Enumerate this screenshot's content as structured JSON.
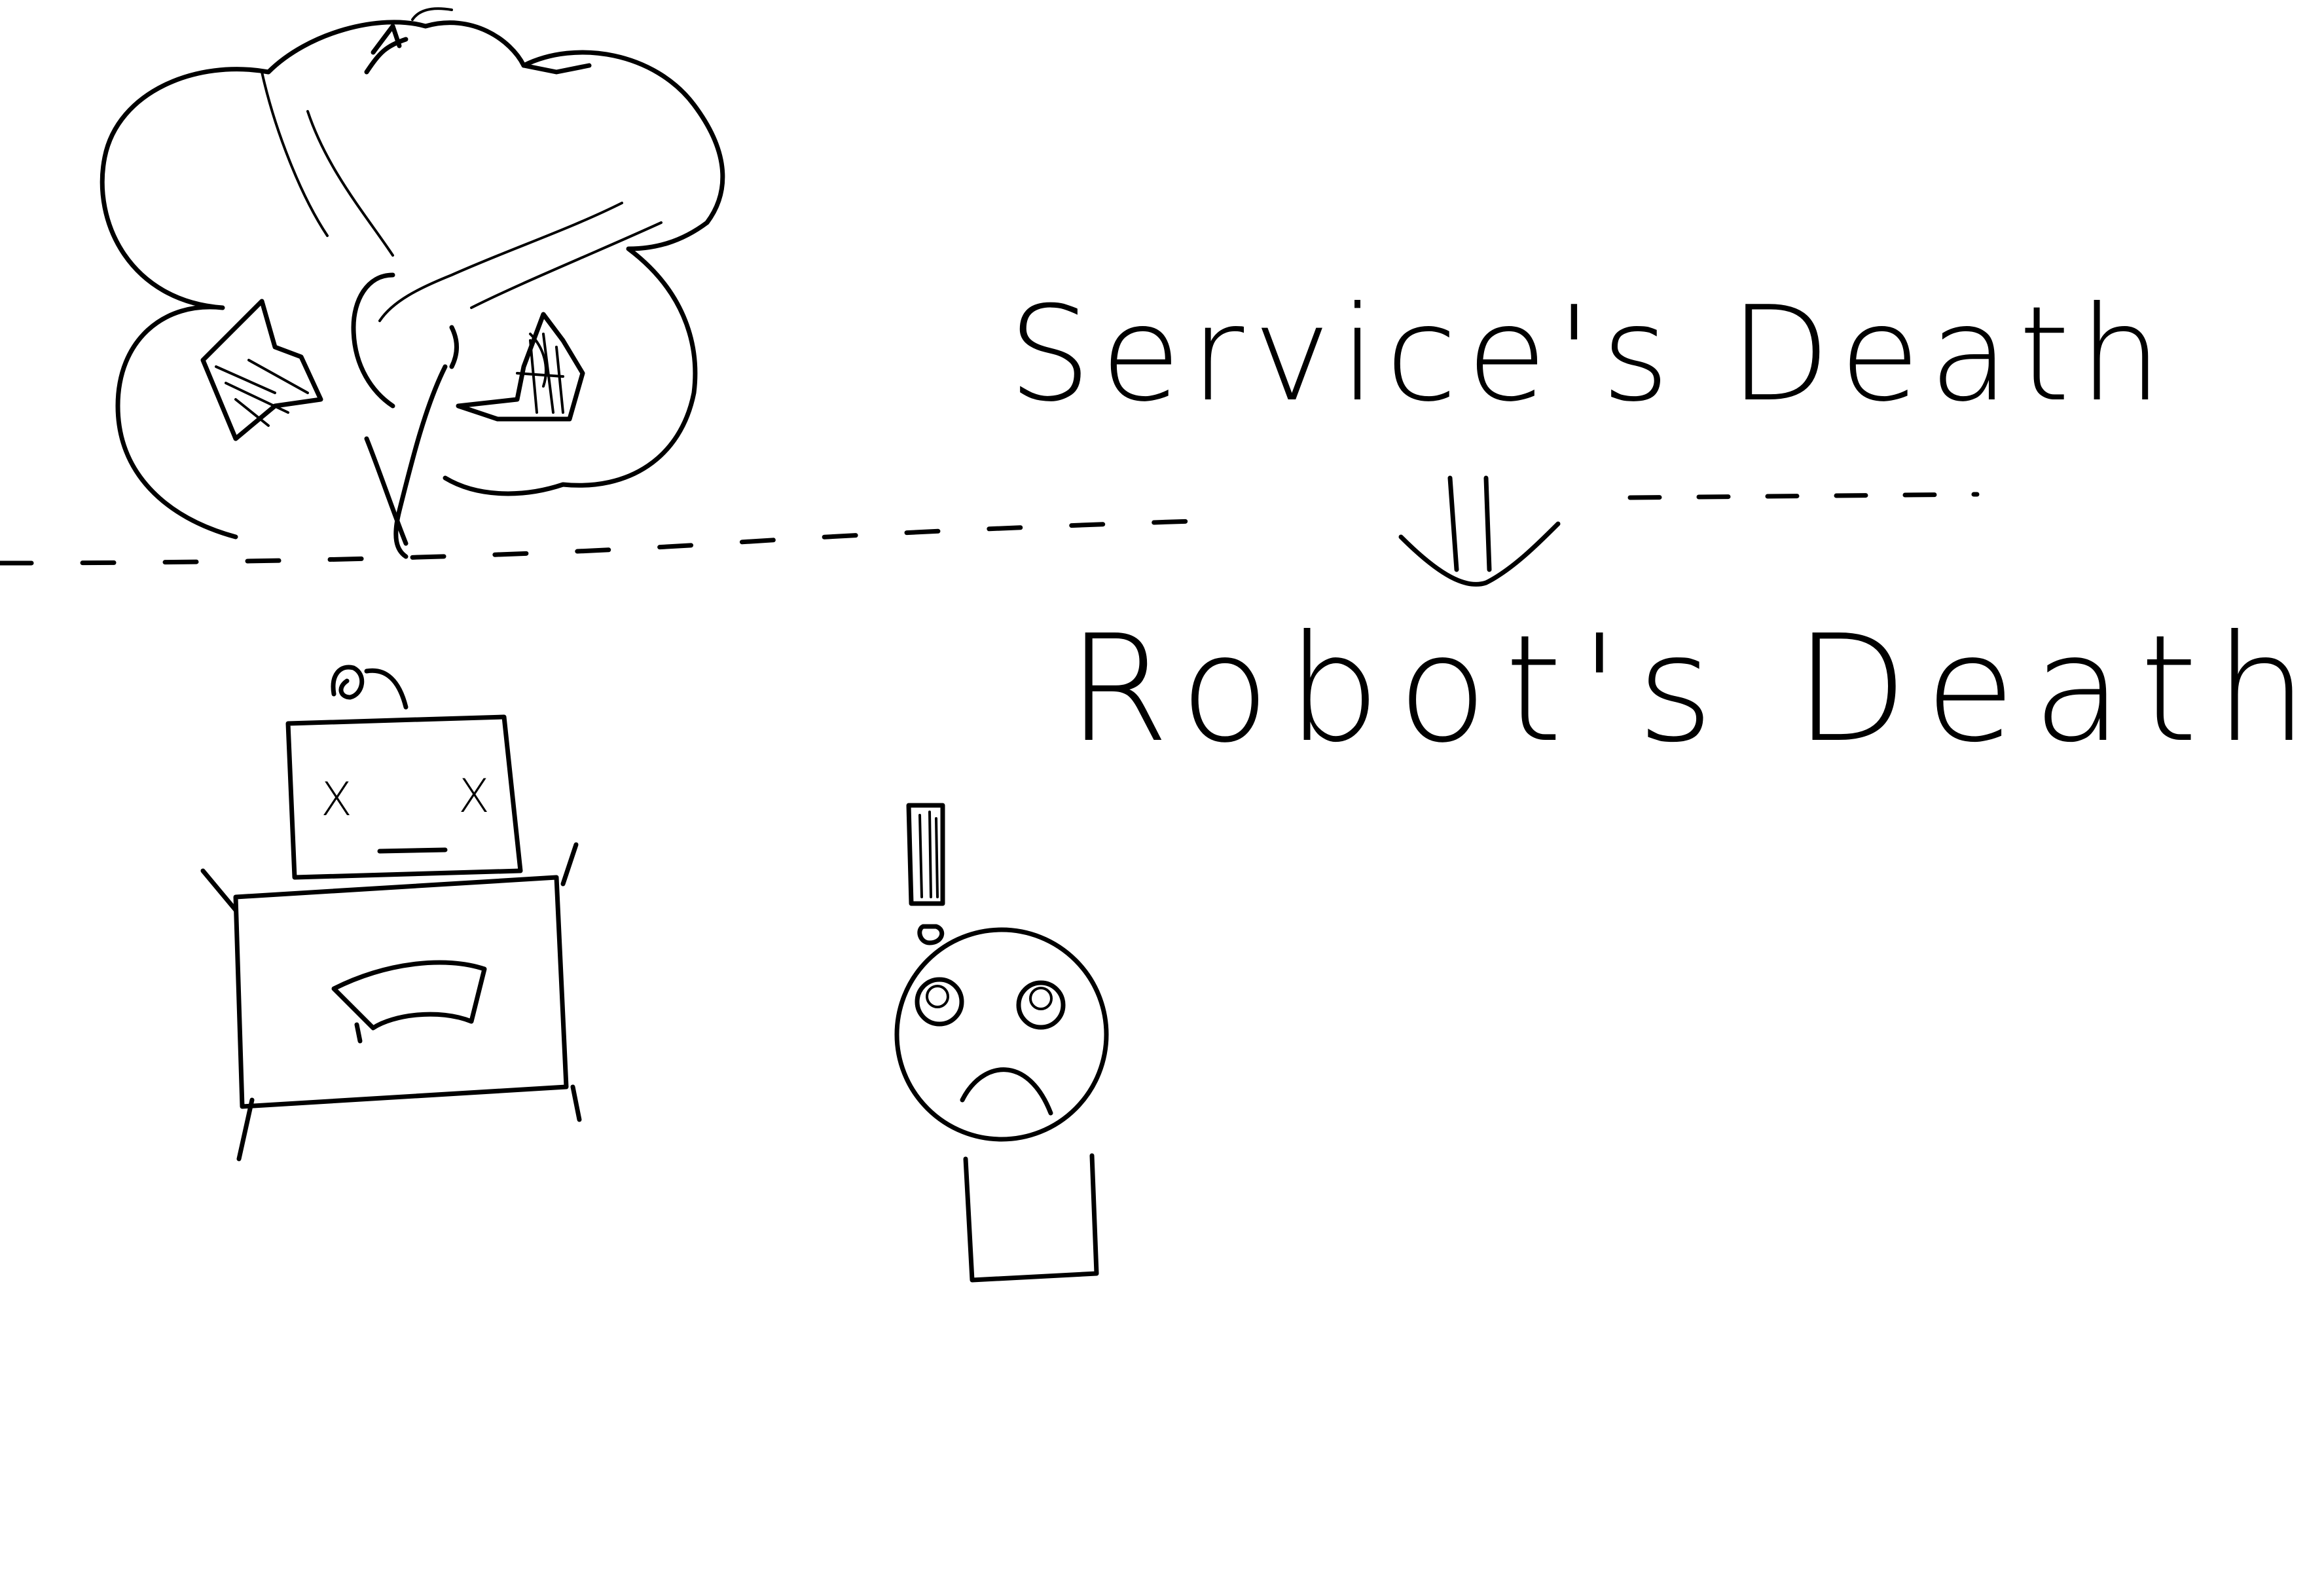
{
  "diagram": {
    "top_label": "Service's Death",
    "bottom_label": "Robot's Death",
    "robot_eyes": "X",
    "arrow_meaning": "implies",
    "colors": {
      "ink": "#000000",
      "paper": "#ffffff"
    },
    "icons": {
      "explosion": "explosion-cloud-icon",
      "implies_arrow": "double-down-arrow-icon",
      "robot": "broken-robot-icon",
      "person": "surprised-person-icon",
      "exclamation": "exclamation-mark-icon"
    }
  }
}
